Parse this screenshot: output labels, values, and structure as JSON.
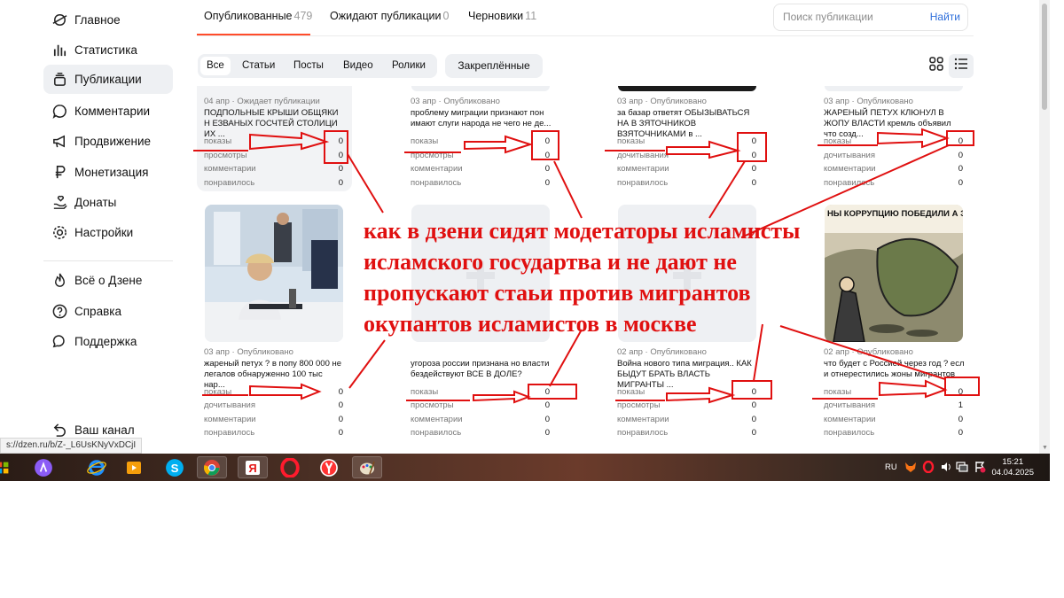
{
  "sidebar": {
    "items": [
      {
        "label": "Главное",
        "icon": "zen-logo-icon"
      },
      {
        "label": "Статистика",
        "icon": "bar-chart-icon"
      },
      {
        "label": "Публикации",
        "icon": "stack-icon",
        "active": true
      },
      {
        "label": "Комментарии",
        "icon": "comment-icon"
      },
      {
        "label": "Продвижение",
        "icon": "megaphone-icon"
      },
      {
        "label": "Монетизация",
        "icon": "ruble-icon"
      },
      {
        "label": "Донаты",
        "icon": "donate-hand-icon"
      },
      {
        "label": "Настройки",
        "icon": "gear-icon"
      }
    ],
    "secondary": [
      {
        "label": "Всё о Дзене",
        "icon": "flame-icon"
      },
      {
        "label": "Справка",
        "icon": "question-circle-icon"
      },
      {
        "label": "Поддержка",
        "icon": "chat-bubbles-icon"
      }
    ],
    "channel": {
      "label": "Ваш канал",
      "icon": "back-arrow-icon"
    }
  },
  "tabs": [
    {
      "label": "Опубликованные",
      "count": "479",
      "active": true
    },
    {
      "label": "Ожидают публикации",
      "count": "0"
    },
    {
      "label": "Черновики",
      "count": "11"
    }
  ],
  "search": {
    "placeholder": "Поиск публикации",
    "button": "Найти"
  },
  "filters": [
    "Все",
    "Статьи",
    "Посты",
    "Видео",
    "Ролики"
  ],
  "pinned_label": "Закреплённые",
  "view_icons": [
    "grid-view-icon",
    "list-view-icon"
  ],
  "cards_row1": [
    {
      "meta": "04 апр · Ожидает публикации",
      "title": "ПОДПОЛЬНЫЕ КРЫШИ ОБЩЯКИ Н ЕЗВАНЫХ ГОСЧТЕЙ СТОЛИЦИ ИХ ...",
      "stats": [
        {
          "k": "показы",
          "v": "0"
        },
        {
          "k": "просмотры",
          "v": "0"
        },
        {
          "k": "комментарии",
          "v": "0"
        },
        {
          "k": "понравилось",
          "v": "0"
        }
      ]
    },
    {
      "meta": "03 апр · Опубликовано",
      "title": "проблему миграции признают пон имают слуги народа не чего не де...",
      "stats": [
        {
          "k": "показы",
          "v": "0"
        },
        {
          "k": "просмотры",
          "v": "0"
        },
        {
          "k": "комментарии",
          "v": "0"
        },
        {
          "k": "понравилось",
          "v": "0"
        }
      ]
    },
    {
      "meta": "03 апр · Опубликовано",
      "title": "за базар ответят ОБЫЗЫВАТЬСЯ НА В ЗЯТОЧНИКОВ ВЗЯТОЧНИКАМИ в ...",
      "stats": [
        {
          "k": "показы",
          "v": "0"
        },
        {
          "k": "дочитывания",
          "v": "0"
        },
        {
          "k": "комментарии",
          "v": "0"
        },
        {
          "k": "понравилось",
          "v": "0"
        }
      ]
    },
    {
      "meta": "03 апр · Опубликовано",
      "title": "ЖАРЕНЫЙ ПЕТУХ КЛЮНУЛ В ЖОПУ ВЛАСТИ кремль объявил что созд...",
      "stats": [
        {
          "k": "показы",
          "v": "0"
        },
        {
          "k": "дочитывания",
          "v": "0"
        },
        {
          "k": "комментарии",
          "v": "0"
        },
        {
          "k": "понравилось",
          "v": "0"
        }
      ]
    }
  ],
  "cards_row2": [
    {
      "meta": "03 апр · Опубликовано",
      "title": "жареный петух ? в попу 800 000 не легалов обнаруженно 100 тыс нар...",
      "stats": [
        {
          "k": "показы",
          "v": "0"
        },
        {
          "k": "дочитывания",
          "v": "0"
        },
        {
          "k": "комментарии",
          "v": "0"
        },
        {
          "k": "понравилось",
          "v": "0"
        }
      ]
    },
    {
      "meta": "",
      "title": "угороза россии признана но власти бездействуют ВСЕ В ДОЛЕ?",
      "stats": [
        {
          "k": "показы",
          "v": "0"
        },
        {
          "k": "просмотры",
          "v": "0"
        },
        {
          "k": "комментарии",
          "v": "0"
        },
        {
          "k": "понравилось",
          "v": "0"
        }
      ]
    },
    {
      "meta": "02 апр · Опубликовано",
      "title": "Война нового типа миграция.. КАК БЫДУТ БРАТЬ ВЛАСТЬ МИГРАНТЫ ...",
      "stats": [
        {
          "k": "показы",
          "v": "0"
        },
        {
          "k": "просмотры",
          "v": "0"
        },
        {
          "k": "комментарии",
          "v": "0"
        },
        {
          "k": "понравилось",
          "v": "0"
        }
      ]
    },
    {
      "meta": "02 апр · Опубликовано",
      "title": "что будет с Россией через год ? есл и отнерестились жоны мигрантов",
      "stats": [
        {
          "k": "показы",
          "v": "0"
        },
        {
          "k": "дочитывания",
          "v": "1"
        },
        {
          "k": "комментарии",
          "v": "0"
        },
        {
          "k": "понравилось",
          "v": "0"
        }
      ]
    }
  ],
  "overlay_text": "как в дзени сидят модетаторы исламисты исламского государтва и не дают не пропускают стаьи против мигрантов окупантов исламистов в москве",
  "cartoon_caption": "НЫ КОРРУПЦИЮ ПОБЕДИЛИ А ЭТО - ТРОФЕИ!!!",
  "status_url": "s://dzen.ru/b/Z-_L6UsKNyVxDCjI",
  "taskbar": {
    "icons": [
      "windows-start-icon",
      "alice-assistant-icon",
      "internet-explorer-icon",
      "media-player-icon",
      "skype-icon",
      "chrome-icon",
      "yandex-icon",
      "opera-icon",
      "yandex-browser-icon",
      "paint-icon"
    ],
    "lang": "RU",
    "time": "15:21",
    "date": "04.04.2025"
  },
  "colors": {
    "accent": "#ff4c2b",
    "annotation": "#e01010",
    "link": "#2f6fdb"
  }
}
